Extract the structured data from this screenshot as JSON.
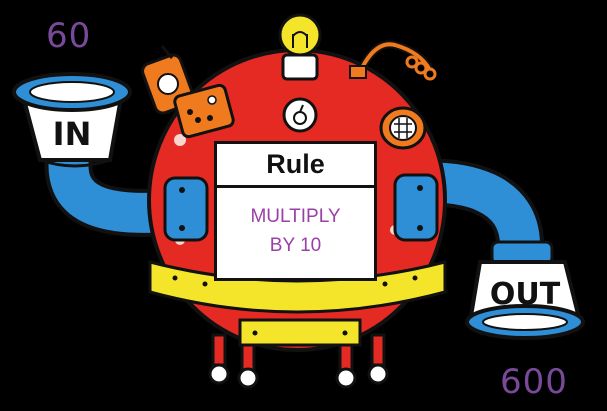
{
  "input": {
    "value": "60",
    "label": "IN"
  },
  "output": {
    "value": "600",
    "label": "OUT"
  },
  "rule": {
    "title": "Rule",
    "line1": "MULTIPLY",
    "line2": "BY 10"
  },
  "colors": {
    "background": "#000000",
    "body": "#e42a22",
    "pipe": "#2f8fd6",
    "accent_yellow": "#f5e52a",
    "accent_orange": "#f07a1e",
    "number_purple": "#7a4a9a",
    "rule_text_purple": "#9b3fa8"
  },
  "icons": [
    "light-bulb-icon",
    "dial-icon",
    "gear-icon",
    "porthole-icon",
    "control-panel-icon",
    "coil-pipe-icon"
  ]
}
